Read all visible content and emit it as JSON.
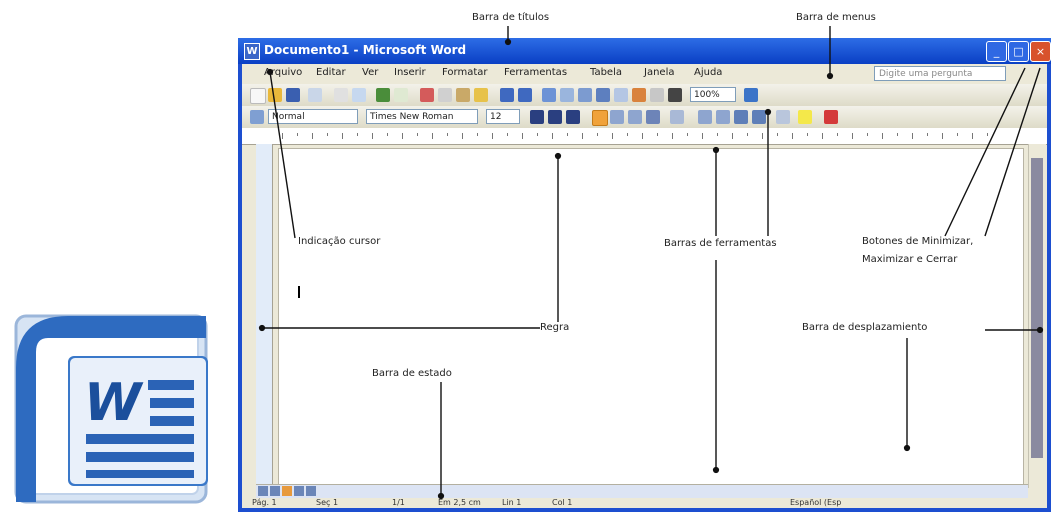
{
  "annotations": {
    "title_bar": "Barra de títulos",
    "menu_bar": "Barra de menus",
    "insertion_pointer": "Indicação cursor",
    "toolbars": "Barras de ferramentas",
    "window_buttons_line1": "Botones de Minimizar,",
    "window_buttons_line2": "Maximizar e Cerrar",
    "ruler": "Regra",
    "scroll_bar": "Barra de desplazamiento",
    "status_bar": "Barra de estado"
  },
  "window": {
    "title": "Documento1 - Microsoft Word",
    "app_icon": "W",
    "minimize": "_",
    "maximize": "□",
    "close": "×"
  },
  "menu": {
    "items": [
      "Arquivo",
      "Editar",
      "Ver",
      "Inserir",
      "Formatar",
      "Ferramentas",
      "Tabela",
      "Janela",
      "Ajuda"
    ],
    "help_placeholder": "Digite uma pergunta"
  },
  "toolbar": {
    "style_value": "Normal",
    "font_value": "Times New Roman",
    "size_value": "12",
    "zoom_value": "100%"
  },
  "status": {
    "page": "Pág. 1",
    "section": "Seç 1",
    "pages": "1/1",
    "position": "Em 2,5 cm",
    "line": "Lin 1",
    "column": "Col 1",
    "language": "Español (Esp"
  },
  "logo": {
    "letter": "W",
    "colors": {
      "dark": "#1b4f9c",
      "mid": "#3a78c9",
      "light": "#d7e4f4"
    }
  },
  "colors": {
    "titlebar": "#0a3fc4",
    "client": "#ece9d8",
    "close": "#d8522c"
  }
}
